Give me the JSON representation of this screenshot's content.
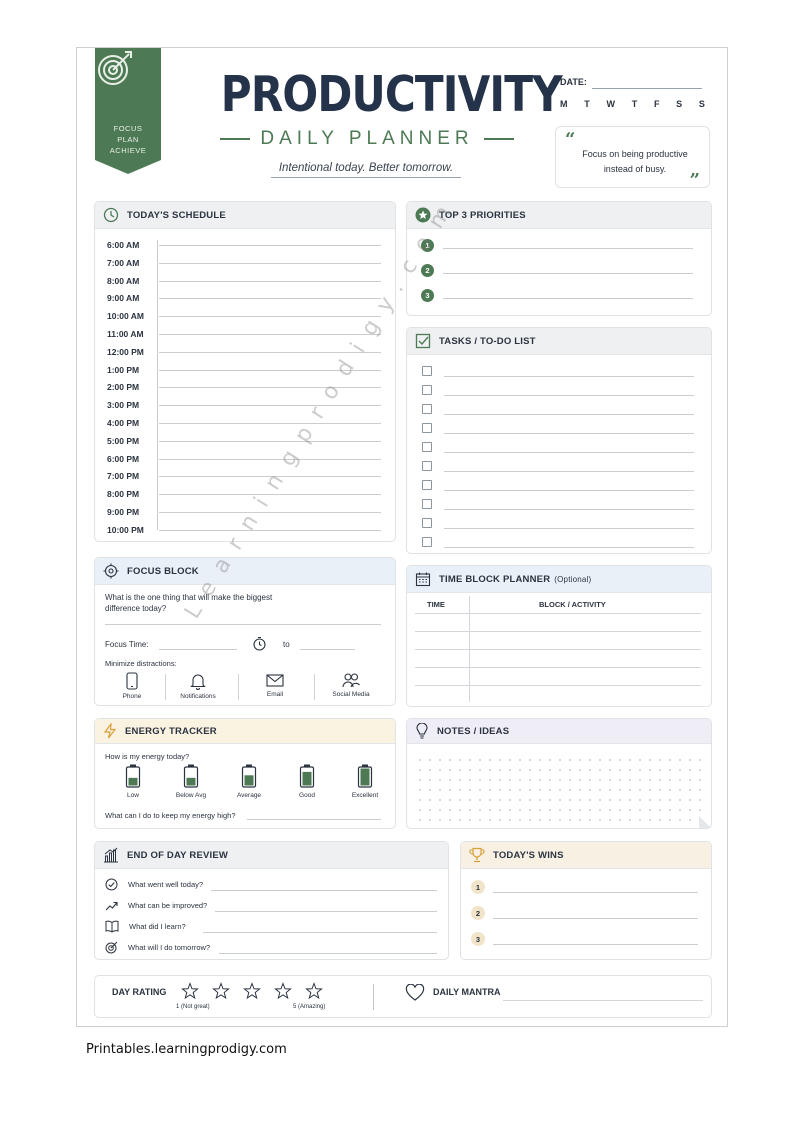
{
  "header": {
    "ribbon_lines": [
      "FOCUS",
      "PLAN",
      "ACHIEVE"
    ],
    "title": "PRODUCTIVITY",
    "subtitle": "DAILY PLANNER",
    "tagline": "Intentional today. Better tomorrow.",
    "date_label": "DATE:",
    "weekdays": [
      "M",
      "T",
      "W",
      "T",
      "F",
      "S",
      "S"
    ],
    "quote_open": "“",
    "quote_text": "Focus on being productive instead of busy.",
    "quote_close": "”"
  },
  "colors": {
    "accent_green": "#4d7a55",
    "navy": "#24324a"
  },
  "schedule": {
    "title": "TODAY'S SCHEDULE",
    "times": [
      "6:00 AM",
      "7:00 AM",
      "8:00 AM",
      "9:00 AM",
      "10:00 AM",
      "11:00 AM",
      "12:00 PM",
      "1:00 PM",
      "2:00 PM",
      "3:00 PM",
      "4:00 PM",
      "5:00 PM",
      "6:00 PM",
      "7:00 PM",
      "8:00 PM",
      "9:00 PM",
      "10:00 PM"
    ]
  },
  "priorities": {
    "title": "TOP 3 PRIORITIES",
    "numbers": [
      "1",
      "2",
      "3"
    ]
  },
  "tasks": {
    "title": "TASKS / TO-DO LIST"
  },
  "focus": {
    "title": "FOCUS BLOCK",
    "question": "What is the one thing that will make the biggest difference today?",
    "focus_time_label": "Focus Time:",
    "to_label": "to",
    "minimize_label": "Minimize distractions:",
    "distractions": [
      {
        "label": "Phone",
        "icon": "phone-icon"
      },
      {
        "label": "Notifications",
        "icon": "bell-icon"
      },
      {
        "label": "Email",
        "icon": "envelope-icon"
      },
      {
        "label": "Social Media",
        "icon": "people-icon"
      }
    ]
  },
  "time_block": {
    "title": "TIME BLOCK PLANNER",
    "note": "(Optional)",
    "col_time": "TIME",
    "col_activity": "BLOCK / ACTIVITY"
  },
  "energy": {
    "title": "ENERGY TRACKER",
    "question": "How is my energy today?",
    "levels": [
      "Low",
      "Below Avg",
      "Average",
      "Good",
      "Excellent"
    ],
    "keep_high": "What can I do to keep my energy high?"
  },
  "notes": {
    "title": "NOTES / IDEAS"
  },
  "review": {
    "title": "END OF DAY REVIEW",
    "items": [
      {
        "text": "What went well today?",
        "icon": "check-circle-icon"
      },
      {
        "text": "What can be improved?",
        "icon": "trend-up-icon"
      },
      {
        "text": "What did I learn?",
        "icon": "book-icon"
      },
      {
        "text": "What will I do tomorrow?",
        "icon": "target-icon"
      }
    ]
  },
  "wins": {
    "title": "TODAY'S WINS",
    "numbers": [
      "1",
      "2",
      "3"
    ]
  },
  "bottom": {
    "rating_label": "DAY RATING",
    "rating_low": "1 (Not great)",
    "rating_high": "5 (Amazing)",
    "mantra_label": "DAILY MANTRA"
  },
  "watermark": "Learningprodigy.com",
  "footer": "Printables.learningprodigy.com"
}
